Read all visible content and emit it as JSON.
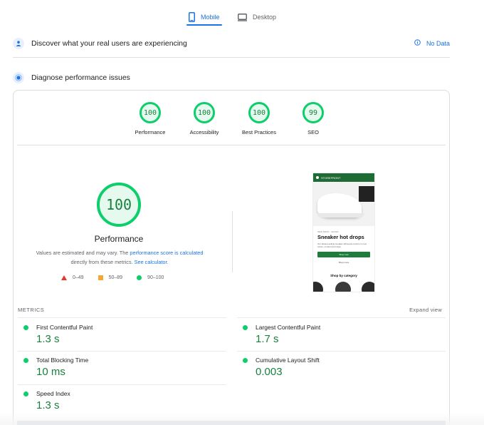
{
  "tabs": {
    "mobile": "Mobile",
    "desktop": "Desktop"
  },
  "field_data": {
    "title": "Discover what your real users are experiencing",
    "no_data": "No Data"
  },
  "lab": {
    "title": "Diagnose performance issues"
  },
  "categories": [
    {
      "score": "100",
      "label": "Performance"
    },
    {
      "score": "100",
      "label": "Accessibility"
    },
    {
      "score": "100",
      "label": "Best Practices"
    },
    {
      "score": "99",
      "label": "SEO"
    }
  ],
  "main_score": {
    "score": "100",
    "label": "Performance",
    "note_prefix": "Values are estimated and may vary. The ",
    "note_link1": "performance score is calculated",
    "note_middle": " directly from these metrics. ",
    "note_link2": "See calculator."
  },
  "legend": {
    "fail": "0–49",
    "average": "50–89",
    "pass": "90–100"
  },
  "preview": {
    "brand": "STOREFRONT",
    "small": "NEW DROP · SHOES",
    "heading": "Sneaker hot drops",
    "body": "Our fastest-selling sneaker silhouette returns in new colors, comfort and style.",
    "button": "Shop now",
    "link": "Shop more",
    "shop": "Shop by category"
  },
  "metrics": {
    "header": "METRICS",
    "expand": "Expand view",
    "items": [
      {
        "name": "First Contentful Paint",
        "value": "1.3 s"
      },
      {
        "name": "Largest Contentful Paint",
        "value": "1.7 s"
      },
      {
        "name": "Total Blocking Time",
        "value": "10 ms"
      },
      {
        "name": "Cumulative Layout Shift",
        "value": "0.003"
      },
      {
        "name": "Speed Index",
        "value": "1.3 s"
      }
    ]
  },
  "colors": {
    "accent": "#1a73e8",
    "pass": "#0cce6b",
    "pass_text": "#18803c",
    "average": "#f4a733",
    "fail": "#e5382a"
  }
}
